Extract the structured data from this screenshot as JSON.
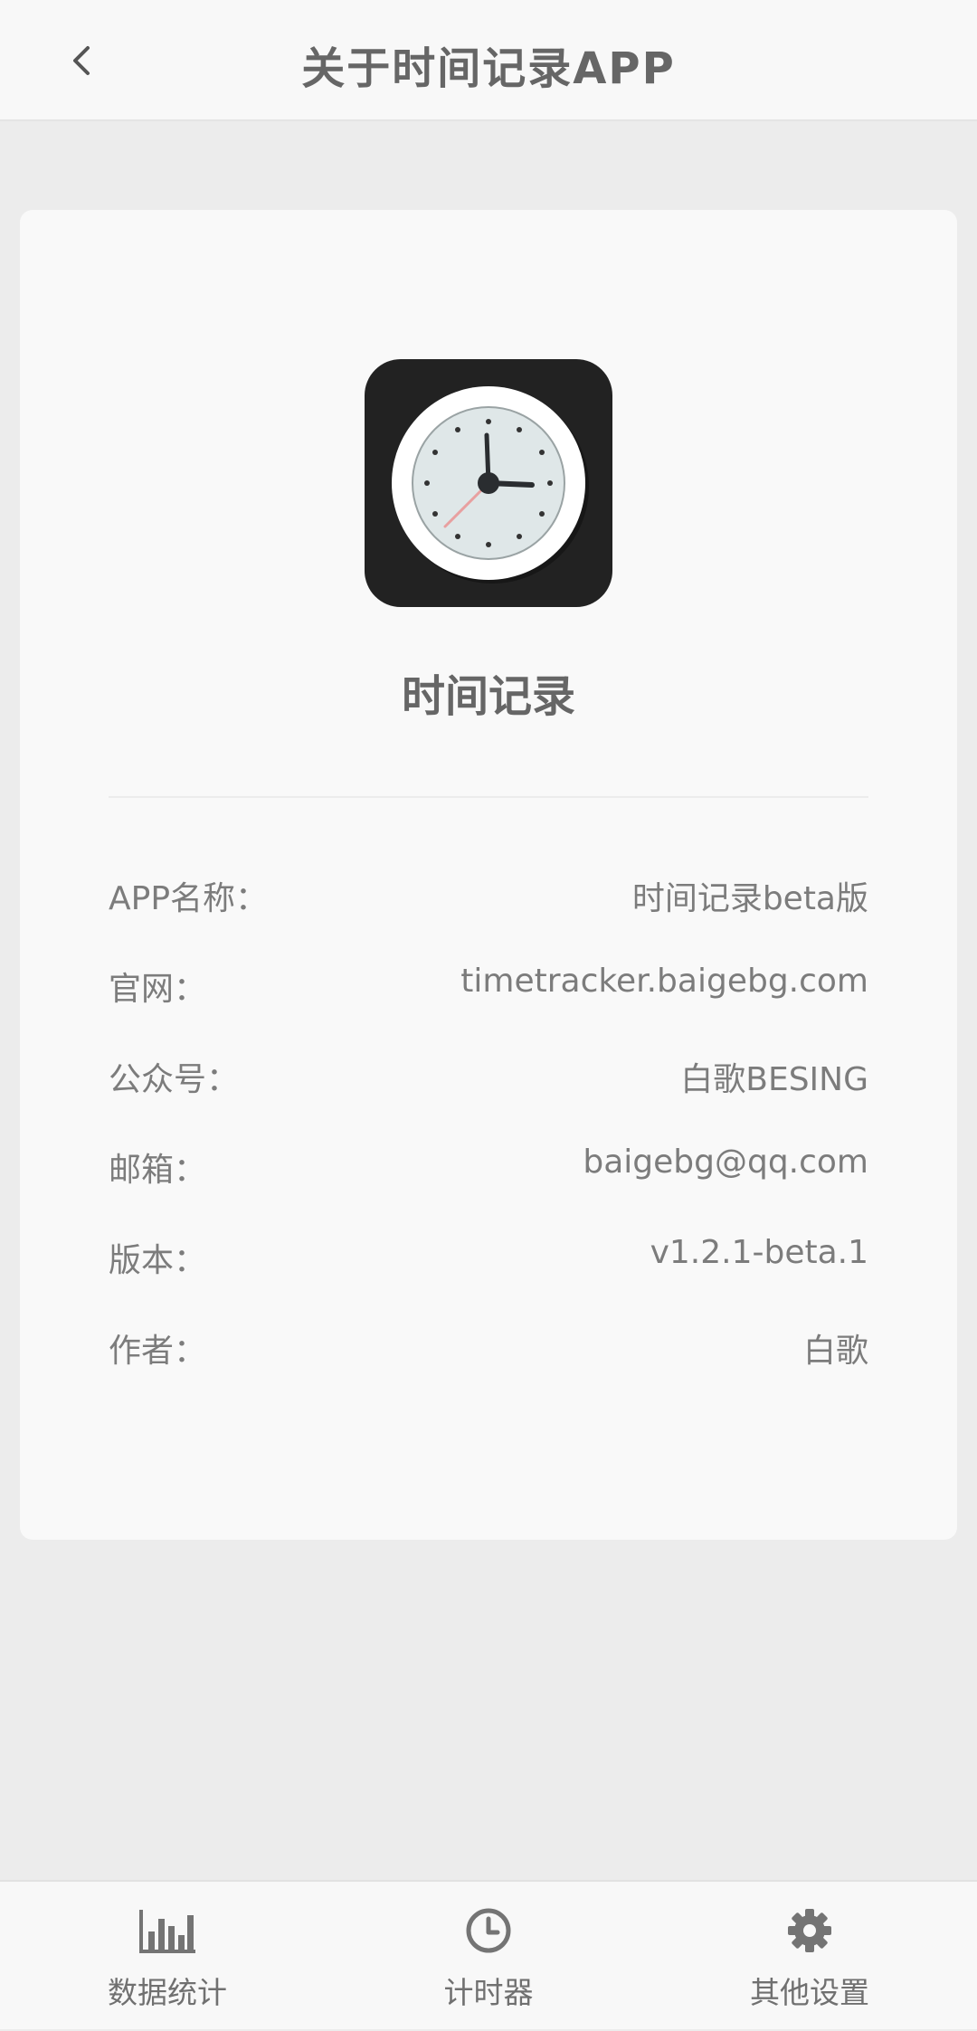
{
  "header": {
    "title": "关于时间记录APP",
    "back_icon": "chevron-left-icon"
  },
  "app": {
    "logo_icon": "clock-icon",
    "name": "时间记录"
  },
  "info": [
    {
      "label": "APP名称：",
      "value": "时间记录beta版"
    },
    {
      "label": "官网：",
      "value": "timetracker.baigebg.com"
    },
    {
      "label": "公众号：",
      "value": "白歌BESING"
    },
    {
      "label": "邮箱：",
      "value": "baigebg@qq.com"
    },
    {
      "label": "版本：",
      "value": "v1.2.1-beta.1"
    },
    {
      "label": "作者：",
      "value": "白歌"
    }
  ],
  "tabbar": {
    "items": [
      {
        "label": "数据统计",
        "icon": "bar-chart-icon"
      },
      {
        "label": "计时器",
        "icon": "clock-icon"
      },
      {
        "label": "其他设置",
        "icon": "gear-icon"
      }
    ]
  },
  "colors": {
    "background": "#ececec",
    "card": "#f9f9f9",
    "text": "#6f6f6f",
    "logo_bg": "#222222"
  }
}
